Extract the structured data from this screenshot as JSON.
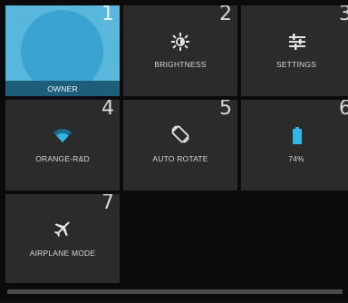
{
  "quick_settings": {
    "tiles": [
      {
        "number": "1",
        "label": "OWNER",
        "icon": "user-avatar-icon"
      },
      {
        "number": "2",
        "label": "BRIGHTNESS",
        "icon": "brightness-icon"
      },
      {
        "number": "3",
        "label": "SETTINGS",
        "icon": "settings-sliders-icon"
      },
      {
        "number": "4",
        "label": "ORANGE-R&D",
        "icon": "wifi-icon"
      },
      {
        "number": "5",
        "label": "AUTO ROTATE",
        "icon": "auto-rotate-icon"
      },
      {
        "number": "6",
        "label": "74%",
        "icon": "battery-icon"
      },
      {
        "number": "7",
        "label": "AIRPLANE MODE",
        "icon": "airplane-icon"
      }
    ],
    "colors": {
      "owner_tile": "#5ab7dc",
      "owner_avatar": "#3aa3d1",
      "tile_background": "#2b2b2b",
      "accent": "#33b5e5"
    }
  }
}
